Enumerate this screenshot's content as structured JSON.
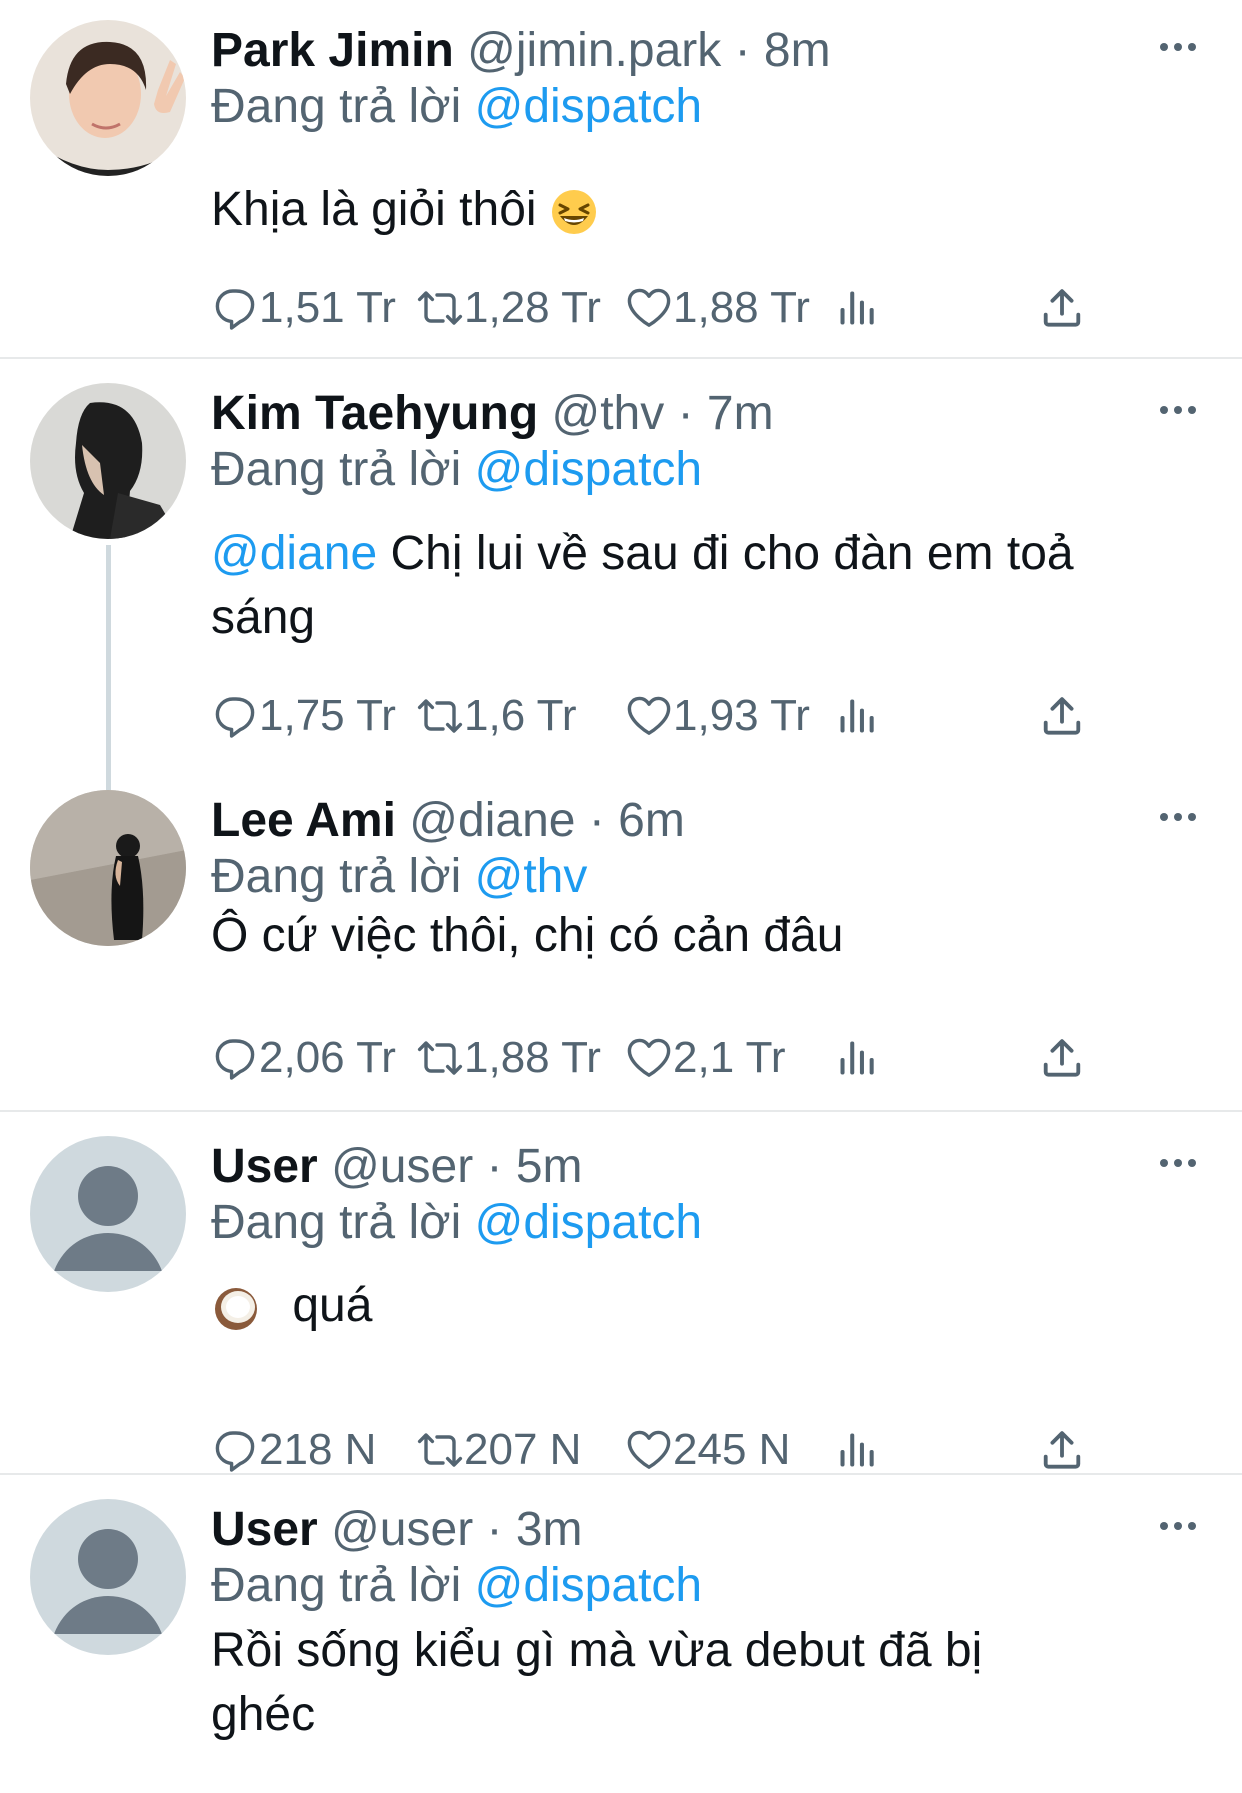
{
  "tweets": [
    {
      "name": "Park Jimin",
      "handle": "@jimin.park",
      "time": "8m",
      "reply_prefix": "Đang trả lời",
      "reply_to": "@dispatch",
      "text": "Khịa là giỏi thôi",
      "emoji": "laughing-face",
      "replies": "1,51 Tr",
      "retweets": "1,28 Tr",
      "likes": "1,88 Tr"
    },
    {
      "name": "Kim Taehyung",
      "handle": "@thv",
      "time": "7m",
      "reply_prefix": "Đang trả lời",
      "reply_to": "@dispatch",
      "mention": "@diane",
      "text_line1": "Chị lui về sau đi cho đàn em toả",
      "text_line2": "sáng",
      "replies": "1,75 Tr",
      "retweets": "1,6 Tr",
      "likes": "1,93 Tr"
    },
    {
      "name": "Lee Ami",
      "handle": "@diane",
      "time": "6m",
      "reply_prefix": "Đang trả lời",
      "reply_to": "@thv",
      "text": "Ô cứ việc thôi, chị có cản đâu",
      "replies": "2,06 Tr",
      "retweets": "1,88 Tr",
      "likes": "2,1 Tr"
    },
    {
      "name": "User",
      "handle": "@user",
      "time": "5m",
      "reply_prefix": "Đang trả lời",
      "reply_to": "@dispatch",
      "emoji": "coconut",
      "text": "quá",
      "replies": "218 N",
      "retweets": "207 N",
      "likes": "245 N"
    },
    {
      "name": "User",
      "handle": "@user",
      "time": "3m",
      "reply_prefix": "Đang trả lời",
      "reply_to": "@dispatch",
      "text_line1": "Rồi sống kiểu gì mà vừa debut đã bị",
      "text_line2": "ghéc"
    }
  ],
  "separator": "·",
  "icons": {
    "reply": "reply-icon",
    "retweet": "retweet-icon",
    "like": "heart-icon",
    "views": "analytics-icon",
    "share": "share-icon",
    "more": "more-icon"
  },
  "colors": {
    "link": "#1d9bf0",
    "secondary": "#536471",
    "text": "#0f1419",
    "divider": "#e7e9ea"
  }
}
